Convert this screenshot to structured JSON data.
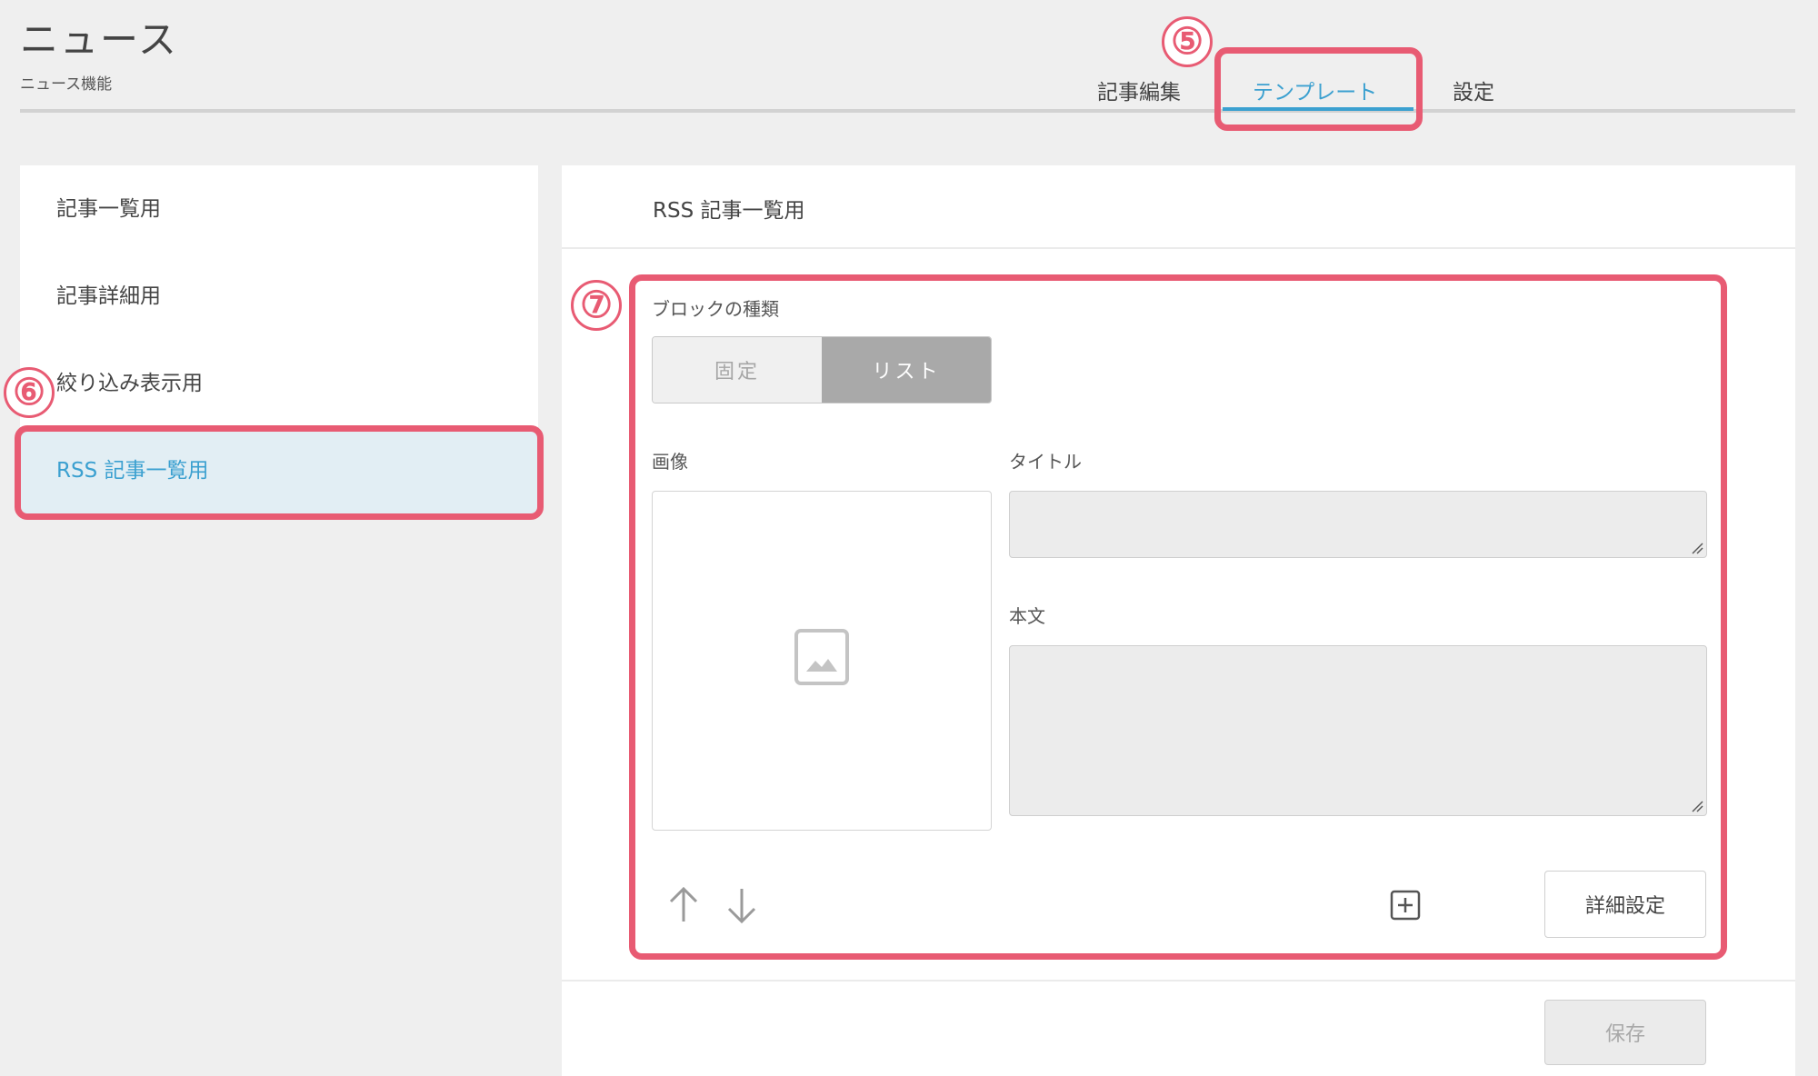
{
  "header": {
    "title": "ニュース",
    "subtitle": "ニュース機能"
  },
  "tabs": [
    {
      "label": "記事編集"
    },
    {
      "label": "テンプレート"
    },
    {
      "label": "設定"
    }
  ],
  "sidebar": {
    "items": [
      {
        "label": "記事一覧用"
      },
      {
        "label": "記事詳細用"
      },
      {
        "label": "絞り込み表示用"
      },
      {
        "label": "RSS 記事一覧用"
      }
    ],
    "selected": "RSS 記事一覧用"
  },
  "panel": {
    "title": "RSS 記事一覧用",
    "block_type_label": "ブロックの種類",
    "segment": {
      "options": [
        "固定",
        "リスト"
      ],
      "selected": "リスト"
    },
    "image_label": "画像",
    "title_label": "タイトル",
    "body_label": "本文",
    "detail_button": "詳細設定",
    "save_button": "保存"
  },
  "annotations": {
    "markers": [
      "⑤",
      "⑥",
      "⑦"
    ],
    "color": "#e85b73"
  },
  "colors": {
    "accent": "#3ba0d0",
    "selected_bg": "#e2eef4",
    "highlight": "#e85b73"
  },
  "icons": [
    "image-placeholder-icon",
    "arrow-up-icon",
    "arrow-down-icon",
    "add-square-icon",
    "resize-handle-icon"
  ]
}
